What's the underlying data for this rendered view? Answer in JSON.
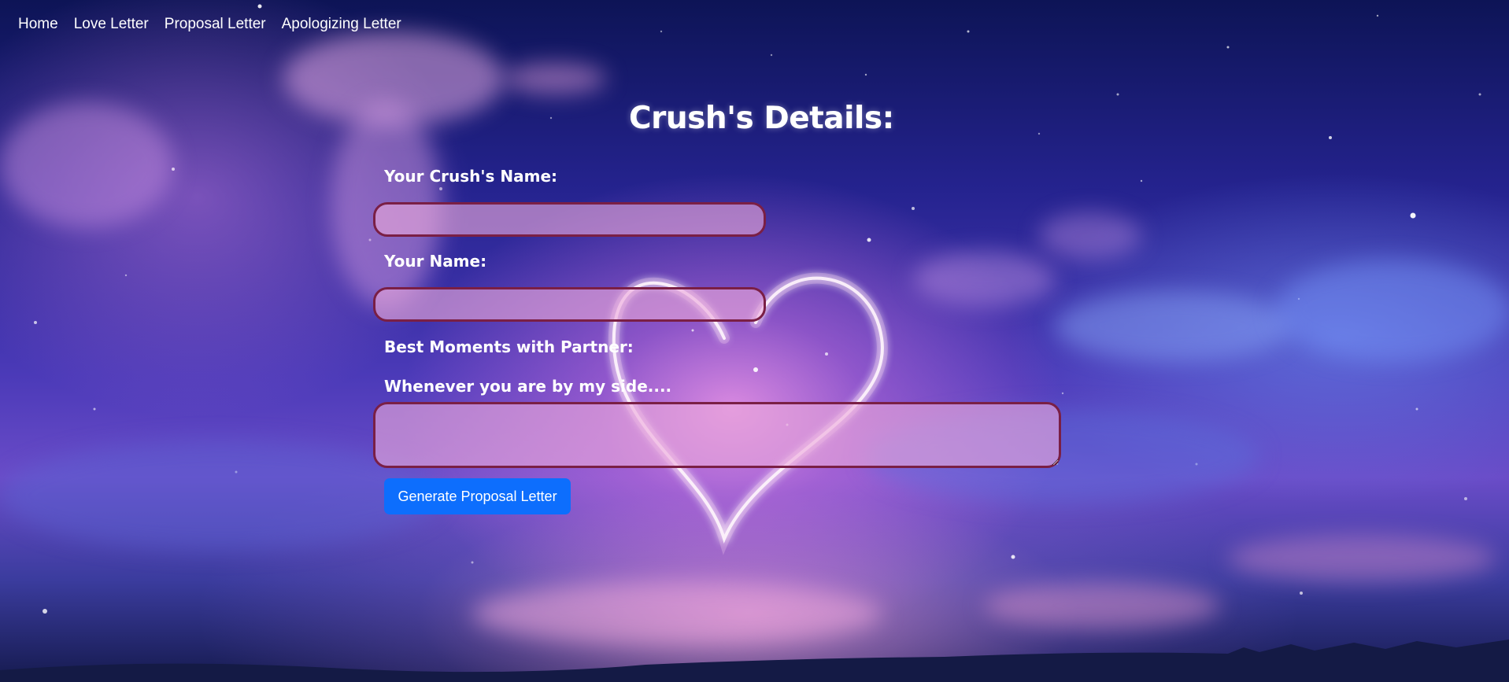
{
  "nav": {
    "items": [
      {
        "label": "Home"
      },
      {
        "label": "Love Letter"
      },
      {
        "label": "Proposal Letter"
      },
      {
        "label": "Apologizing Letter"
      }
    ]
  },
  "form": {
    "title": "Crush's Details:",
    "crush_name_label": "Your Crush's Name:",
    "crush_name_value": "",
    "your_name_label": "Your Name:",
    "your_name_value": "",
    "best_moments_label": "Best Moments with Partner:",
    "side_label": "Whenever you are by my side....",
    "side_value": "",
    "submit_label": "Generate Proposal Letter"
  },
  "colors": {
    "button": "#0d6efd",
    "field_border": "#7a1f45",
    "field_fill": "rgba(236,170,220,0.62)"
  }
}
